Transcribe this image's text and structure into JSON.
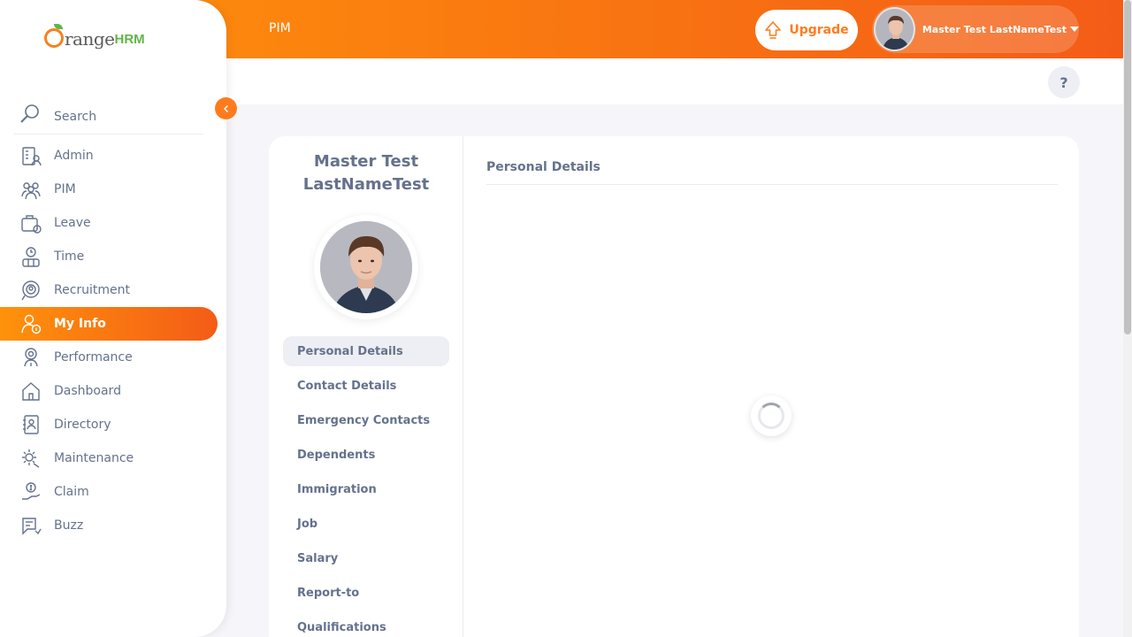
{
  "header": {
    "module": "PIM",
    "upgrade_label": "Upgrade",
    "user_name": "Master Test LastNameTest",
    "help_label": "?"
  },
  "logo": {
    "part1": "range",
    "part2": "HRM"
  },
  "sidebar": {
    "search_label": "Search",
    "items": [
      {
        "label": "Admin",
        "icon": "admin-icon"
      },
      {
        "label": "PIM",
        "icon": "pim-icon"
      },
      {
        "label": "Leave",
        "icon": "leave-icon"
      },
      {
        "label": "Time",
        "icon": "time-icon"
      },
      {
        "label": "Recruitment",
        "icon": "recruitment-icon"
      },
      {
        "label": "My Info",
        "icon": "my-info-icon",
        "active": true
      },
      {
        "label": "Performance",
        "icon": "performance-icon"
      },
      {
        "label": "Dashboard",
        "icon": "dashboard-icon"
      },
      {
        "label": "Directory",
        "icon": "directory-icon"
      },
      {
        "label": "Maintenance",
        "icon": "maintenance-icon"
      },
      {
        "label": "Claim",
        "icon": "claim-icon"
      },
      {
        "label": "Buzz",
        "icon": "buzz-icon"
      }
    ]
  },
  "profile": {
    "name_line1": "Master Test",
    "name_line2": "LastNameTest"
  },
  "tabs": [
    {
      "label": "Personal Details",
      "active": true
    },
    {
      "label": "Contact Details"
    },
    {
      "label": "Emergency Contacts"
    },
    {
      "label": "Dependents"
    },
    {
      "label": "Immigration"
    },
    {
      "label": "Job"
    },
    {
      "label": "Salary"
    },
    {
      "label": "Report-to"
    },
    {
      "label": "Qualifications"
    }
  ],
  "content": {
    "section_title": "Personal Details"
  },
  "colors": {
    "accent": "#ff7b1d",
    "gradient_start": "#ff920b",
    "gradient_end": "#f35c17",
    "text": "#64728c"
  }
}
